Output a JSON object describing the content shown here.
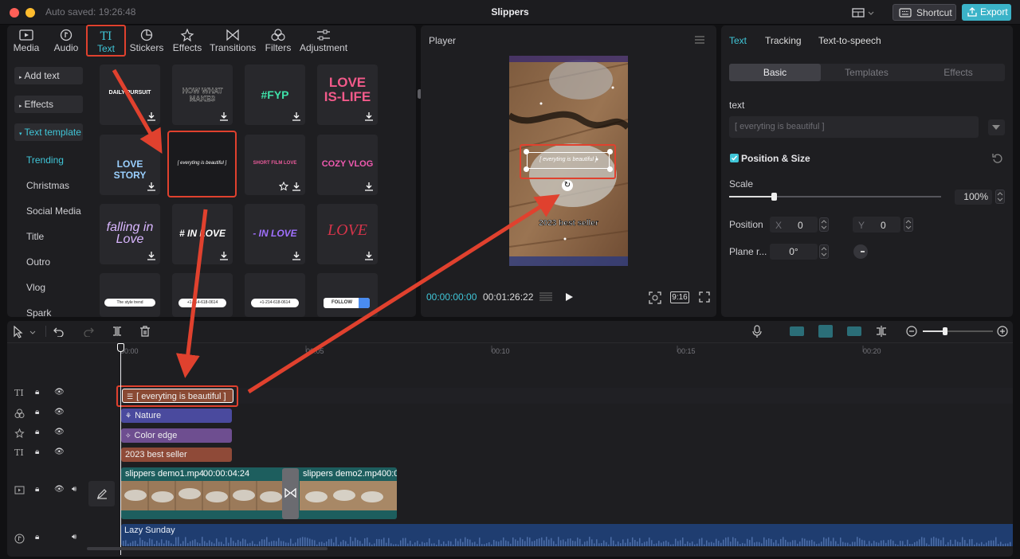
{
  "window": {
    "title": "Slippers",
    "autosaved": "Auto saved: 19:26:48",
    "shortcut_label": "Shortcut",
    "export_label": "Export"
  },
  "colors": {
    "accent": "#40c6d8",
    "highlight": "#e0412e",
    "background": "#1e1e21"
  },
  "media_toolbar": {
    "tabs": [
      {
        "label": "Media",
        "icon": "media-icon"
      },
      {
        "label": "Audio",
        "icon": "audio-icon"
      },
      {
        "label": "Text",
        "icon": "text-icon"
      },
      {
        "label": "Stickers",
        "icon": "sticker-icon"
      },
      {
        "label": "Effects",
        "icon": "effects-icon"
      },
      {
        "label": "Transitions",
        "icon": "transitions-icon"
      },
      {
        "label": "Filters",
        "icon": "filters-icon"
      },
      {
        "label": "Adjustment",
        "icon": "adjustment-icon"
      }
    ],
    "active": "Text"
  },
  "sidebar": {
    "groups": [
      "Add text",
      "Effects",
      "Text template"
    ],
    "items": [
      "Trending",
      "Christmas",
      "Social Media",
      "Title",
      "Outro",
      "Vlog",
      "Spark"
    ],
    "active": "Trending"
  },
  "templates": [
    [
      "DAILY PURSUIT",
      "HOW WHAT MAKES",
      "#FYP",
      "LOVE IS-LIFE"
    ],
    [
      "LOVE STORY",
      "[ everyting is beautiful ]",
      "SHORT FILM LOVE",
      "COZY VLOG"
    ],
    [
      "falling in Love",
      "# IN LOVE",
      "- IN LOVE",
      "LOVE"
    ],
    [
      "The style trend",
      "+1-214-618-0614",
      "+1-214-618-0614",
      "FOLLOW"
    ]
  ],
  "player": {
    "title": "Player",
    "current_time": "00:00:00:00",
    "total_time": "00:01:26:22",
    "ratio": "9:16",
    "overlay_text": "[ everyting is beautiful ]",
    "caption": "2023 best seller"
  },
  "properties": {
    "tabs": [
      "Text",
      "Tracking",
      "Text-to-speech"
    ],
    "active_tab": "Text",
    "subtabs": [
      "Basic",
      "Templates",
      "Effects"
    ],
    "section_label": "text",
    "text_value": "[ everyting is beautiful ]",
    "position_size_label": "Position & Size",
    "scale_label": "Scale",
    "scale_value": "100%",
    "scale_fraction": 0.21,
    "position_label": "Position",
    "x_label": "X",
    "x_value": "0",
    "y_label": "Y",
    "y_value": "0",
    "rotate_label": "Plane r...",
    "rotate_value": "0°"
  },
  "timeline": {
    "ruler": [
      "00:00",
      "00:05",
      "00:10",
      "00:15",
      "00:20"
    ],
    "clips": {
      "text": "[ everyting is beautiful ]",
      "filter": "Nature",
      "effect": "Color edge",
      "caption": "2023 best seller",
      "video1_name": "slippers demo1.mp4",
      "video1_duration": "00:00:04:24",
      "video2_name": "slippers demo2.mp4",
      "video2_duration": "00:0",
      "audio": "Lazy Sunday"
    }
  }
}
